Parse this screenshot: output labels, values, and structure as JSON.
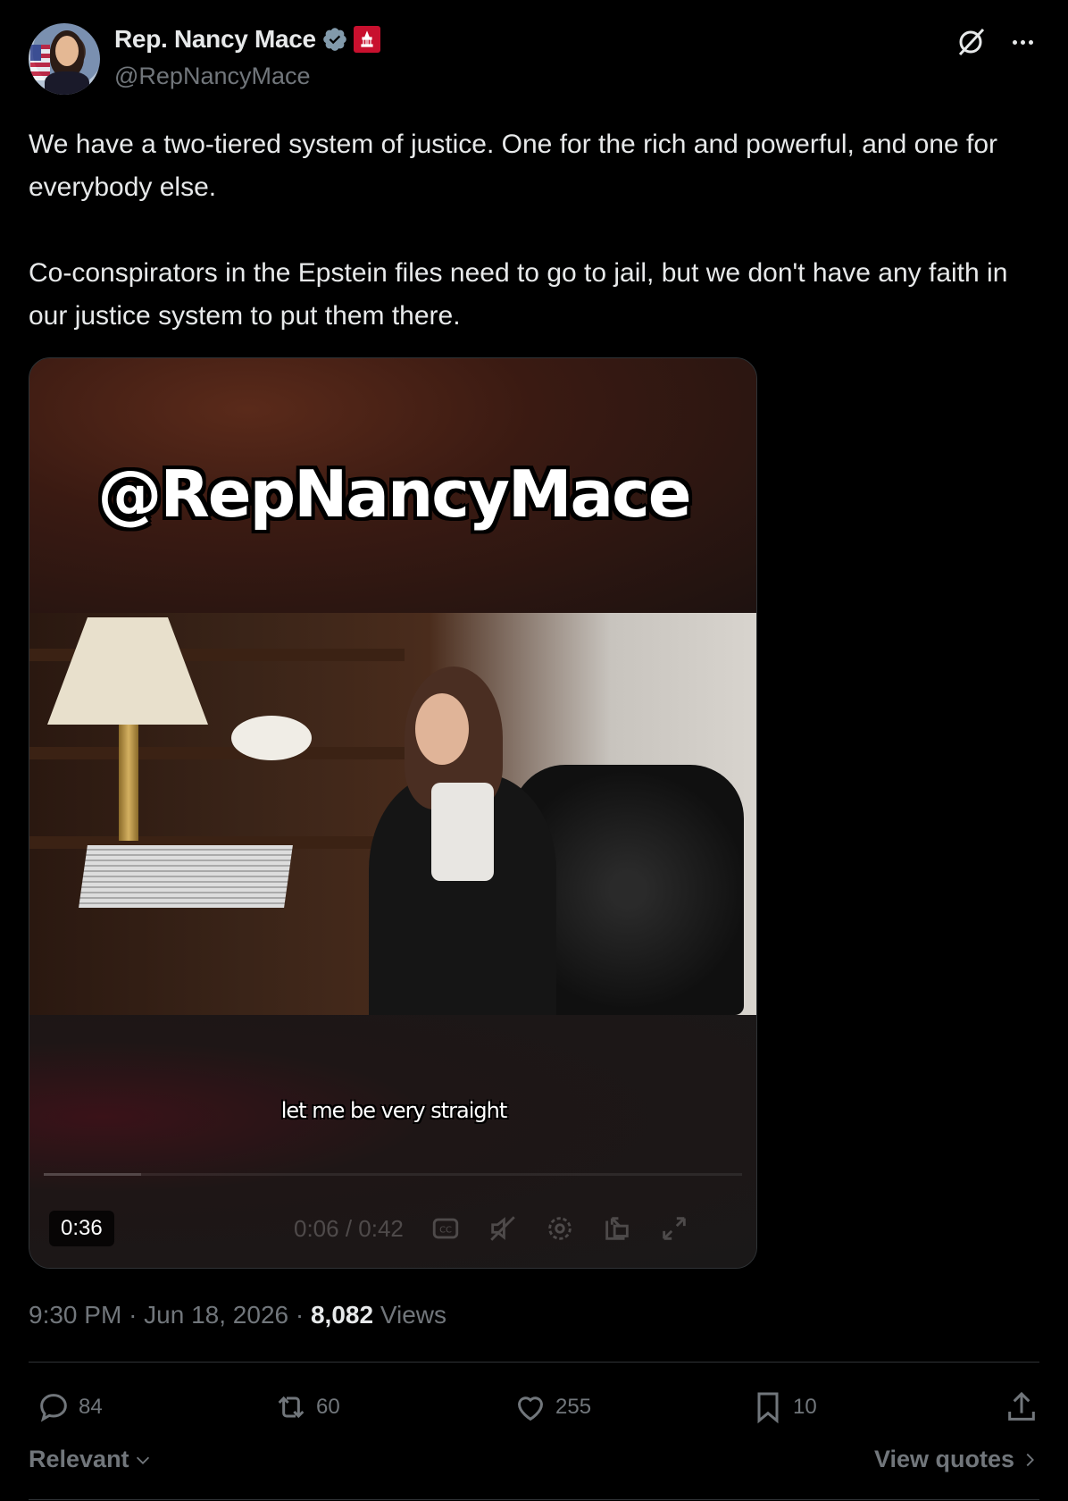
{
  "author": {
    "name": "Rep. Nancy Mace",
    "handle": "@RepNancyMace"
  },
  "tweet": {
    "paragraphs": [
      "We have a two-tiered system of justice. One for the rich and powerful, and one for everybody else.",
      "Co-conspirators in the Epstein files need to go to jail, but we don't have any faith in our justice system to put them there."
    ]
  },
  "video": {
    "overlay_handle": "@RepNancyMace",
    "caption": "let me be very straight",
    "duration_badge": "0:36",
    "time_readout": "0:06 / 0:42",
    "progress": 0.14
  },
  "meta": {
    "time": "9:30 PM",
    "date": "Jun 18, 2026",
    "views_count": "8,082",
    "views_label": "Views"
  },
  "actions": {
    "replies": "84",
    "reposts": "60",
    "likes": "255",
    "bookmarks": "10"
  },
  "footer": {
    "sort_label": "Relevant",
    "view_quotes": "View quotes"
  },
  "colors": {
    "background": "#000000",
    "text": "#e7e9ea",
    "muted": "#71767b",
    "verified": "#829aab",
    "divider": "#2f3336"
  }
}
